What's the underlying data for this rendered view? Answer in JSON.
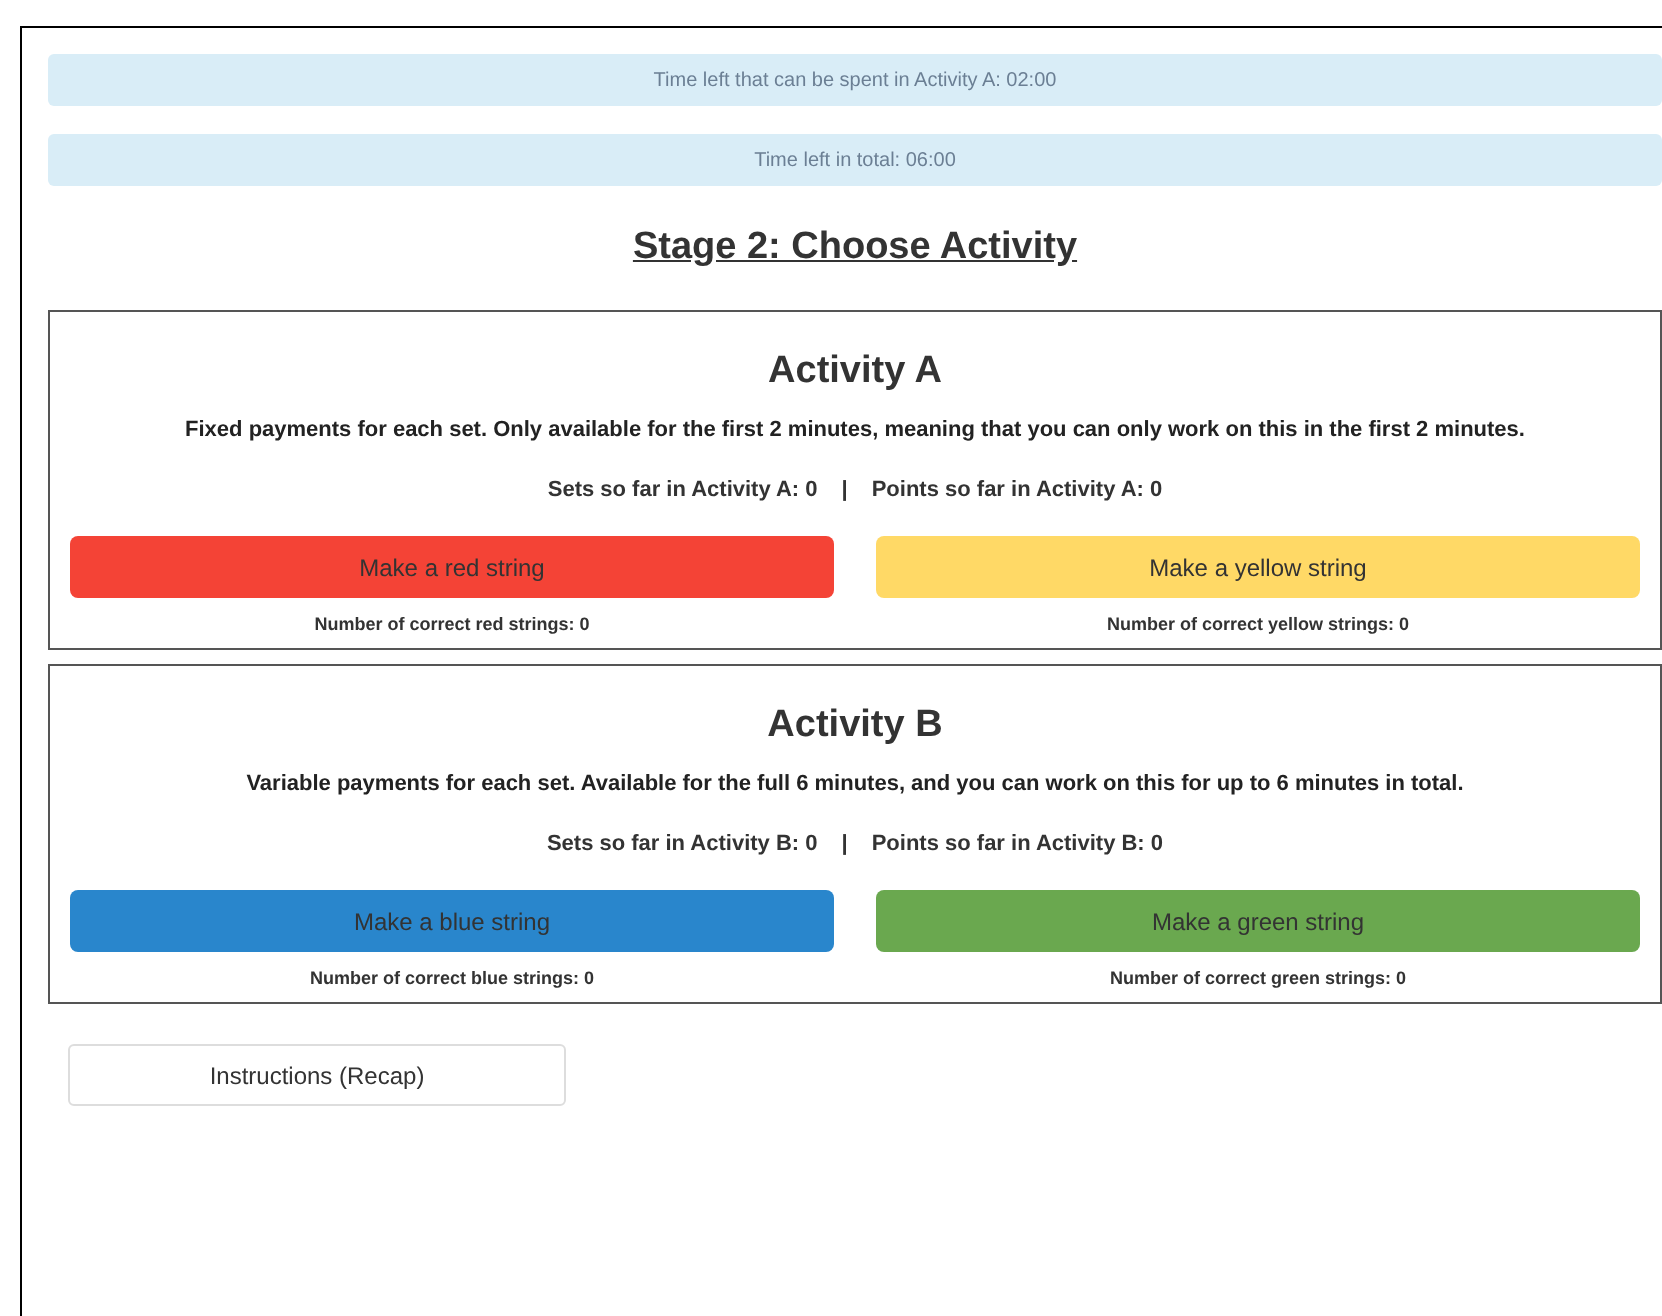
{
  "timers": [
    "Time left that can be spent in Activity A: 02:00",
    "Time left in total: 06:00"
  ],
  "heading": "Stage 2: Choose Activity",
  "activities": [
    {
      "title": "Activity A",
      "description": "Fixed payments for each set. Only available for the first 2 minutes, meaning that you can only work on this in the first 2 minutes.",
      "sets": "Sets so far in Activity A: 0",
      "separator": "|",
      "points": "Points so far in Activity A: 0",
      "buttons": [
        {
          "label": "Make a red string",
          "color": "#f44336",
          "count": "Number of correct red strings: 0"
        },
        {
          "label": "Make a yellow string",
          "color": "#ffd966",
          "count": "Number of correct yellow strings: 0"
        }
      ]
    },
    {
      "title": "Activity B",
      "description": "Variable payments for each set. Available for the full 6 minutes, and you can work on this for up to 6 minutes in total.",
      "sets": "Sets so far in Activity B: 0",
      "separator": "|",
      "points": "Points so far in Activity B: 0",
      "buttons": [
        {
          "label": "Make a blue string",
          "color": "#2986cc",
          "count": "Number of correct blue strings: 0"
        },
        {
          "label": "Make a green string",
          "color": "#6aa84f",
          "count": "Number of correct green strings: 0"
        }
      ]
    }
  ],
  "recap_button": "Instructions (Recap)"
}
